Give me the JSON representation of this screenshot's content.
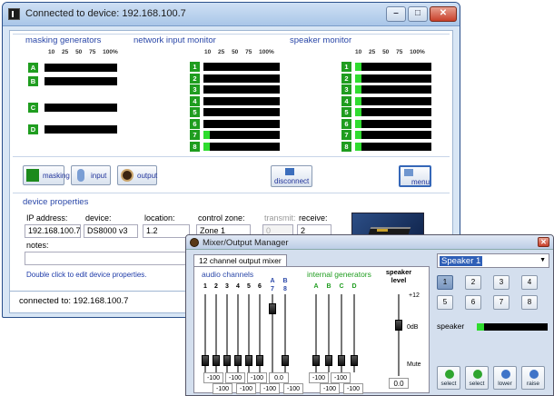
{
  "main_window": {
    "title": "Connected to device: 192.168.100.7",
    "controls": [
      "–",
      "□",
      "✕"
    ]
  },
  "masking_generators": {
    "title": "masking generators",
    "ticks": "10 25 50 75 100%",
    "channels": [
      {
        "label": "A",
        "level": 0
      },
      {
        "label": "B",
        "level": 0
      },
      {
        "label": "C",
        "level": 0
      },
      {
        "label": "D",
        "level": 0
      }
    ]
  },
  "network_input_monitor": {
    "title": "network input monitor",
    "ticks": "10 25 50 75 100%",
    "channels": [
      {
        "label": "1",
        "level": 0
      },
      {
        "label": "2",
        "level": 0
      },
      {
        "label": "3",
        "level": 0
      },
      {
        "label": "4",
        "level": 0
      },
      {
        "label": "5",
        "level": 0
      },
      {
        "label": "6",
        "level": 0
      },
      {
        "label": "7",
        "level": 0.08
      },
      {
        "label": "8",
        "level": 0.08
      }
    ]
  },
  "speaker_monitor": {
    "title": "speaker monitor",
    "ticks": "10 25 50 75 100%",
    "channels": [
      {
        "label": "1",
        "level": 0.08
      },
      {
        "label": "2",
        "level": 0.08
      },
      {
        "label": "3",
        "level": 0.08
      },
      {
        "label": "4",
        "level": 0.08
      },
      {
        "label": "5",
        "level": 0.08
      },
      {
        "label": "6",
        "level": 0.08
      },
      {
        "label": "7",
        "level": 0.08
      },
      {
        "label": "8",
        "level": 0.08
      }
    ]
  },
  "toolbar": {
    "masking": "masking",
    "input": "input",
    "output": "output",
    "disconnect": "disconnect",
    "menu": "menu"
  },
  "device_properties": {
    "title": "device properties",
    "ip_label": "IP address:",
    "ip_value": "192.168.100.7",
    "device_label": "device:",
    "device_value": "DS8000 v3",
    "location_label": "location:",
    "location_value": "1.2",
    "zone_label": "control zone:",
    "zone_value": "Zone 1",
    "transmit_label": "transmit:",
    "transmit_value": "0",
    "receive_label": "receive:",
    "receive_value": "2",
    "notes_label": "notes:",
    "hint": "Double click to edit device properties."
  },
  "status_bar": {
    "text": "connected to:  192.168.100.7"
  },
  "mixer": {
    "title": "Mixer/Output Manager",
    "tab": "12 channel output mixer",
    "audio_channels_label": "audio channels",
    "internal_generators_label": "internal generators",
    "speaker_level_label": "speaker level",
    "audio_channels": [
      "1",
      "2",
      "3",
      "4",
      "5",
      "6",
      "7",
      "8"
    ],
    "audio_ab": [
      "A",
      "B"
    ],
    "generators": [
      "A",
      "B",
      "C",
      "D"
    ],
    "values_top": [
      "-100",
      "-100",
      "-100",
      "0.0",
      "-100",
      "-100"
    ],
    "values_bottom": [
      "-100",
      "-100",
      "-100",
      "-100",
      "-100",
      "-100"
    ],
    "level_plus": "+12",
    "level_zero": "0dB",
    "level_mute": "Mute",
    "speaker_level_value": "0.0",
    "speaker_select": "Speaker 1",
    "speaker_buttons": [
      "1",
      "2",
      "3",
      "4",
      "5",
      "6",
      "7",
      "8"
    ],
    "speaker_meter_label": "speaker",
    "actions": [
      "select",
      "select",
      "lower",
      "raise"
    ]
  }
}
